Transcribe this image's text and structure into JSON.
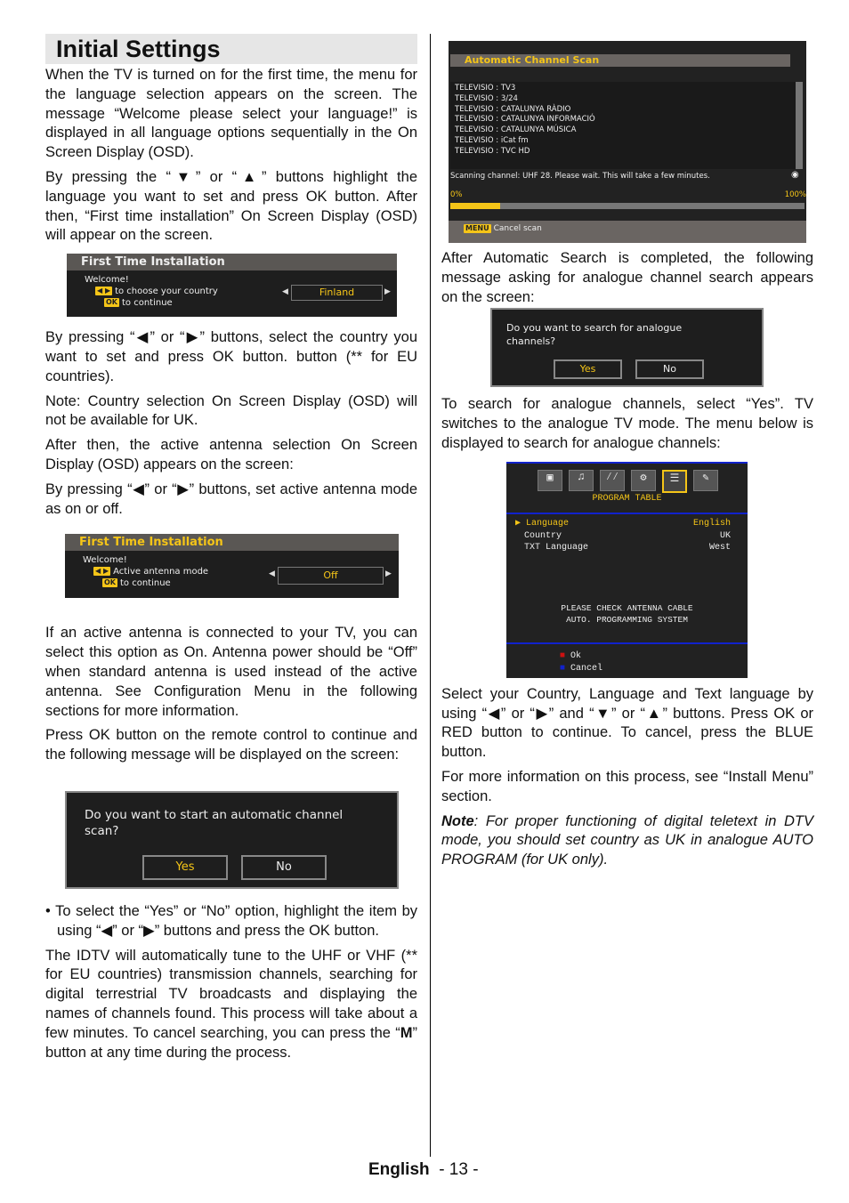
{
  "title": "Initial Settings",
  "left_paragraphs": {
    "p1": "When the TV is turned on for the first time, the menu for the language selection appears on the screen. The message “Welcome please select your language!” is displayed in all language options sequentially in the On Screen Display (OSD).",
    "p2": "By pressing the “▼” or “▲” buttons highlight the language you want to set and press OK button. After then, “First time installation” On Screen Display (OSD) will appear on the screen.",
    "p3": "By pressing “◀” or “▶” buttons, select the country you want to set and press OK button. button (** for EU countries).",
    "p4": "Note: Country selection On Screen Display (OSD) will not be available for UK.",
    "p5": "After then, the active antenna selection On Screen Display (OSD) appears on the screen:",
    "p6": "By pressing “◀” or “▶” buttons, set active antenna mode as on or off.",
    "p7": "If an active antenna is connected to your TV, you can select this option as On. Antenna power should be “Off” when standard antenna is used instead of the active antenna. See Configuration Menu in the following sections for more information.",
    "p8": "Press OK button on the remote control to continue and the following message will be displayed on the screen:",
    "p9": "• To select the “Yes” or “No” option, highlight the item by using “◀” or “▶” buttons and press the OK button.",
    "p10a": "The IDTV will automatically tune to the UHF or VHF (** for EU countries) transmission channels, searching for digital terrestrial TV broadcasts and displaying the names of channels found. This process will take about a few minutes. To cancel searching, you can press the “",
    "p10b": "M",
    "p10c": "” button at any time during the process."
  },
  "right_paragraphs": {
    "p1": "After Automatic Search is completed, the following message asking for analogue channel search appears on the screen:",
    "p2": "To search for analogue channels, select “Yes”.  TV switches to the analogue TV mode. The menu below is displayed to search for analogue channels:",
    "p3": "Select your Country, Language and Text language by using “◀” or “▶” and “▼” or “▲” buttons. Press OK or RED button to continue. To cancel, press the BLUE button.",
    "p4": "For more information on this process, see “Install Menu” section.",
    "p5a": "Note",
    "p5b": ": For proper functioning of digital teletext in DTV mode, you should set country as UK in analogue AUTO PROGRAM (for UK only)."
  },
  "osd_country": {
    "header": "First Time Installation",
    "welcome": "Welcome!",
    "line1": "to choose your country",
    "line2": "to continue",
    "ok_key": "OK",
    "value": "Finland"
  },
  "osd_antenna": {
    "header": "First Time Installation",
    "welcome": "Welcome!",
    "line1": "Active antenna mode",
    "line2": "to continue",
    "ok_key": "OK",
    "value": "Off"
  },
  "osd_scan_prompt": {
    "question": "Do you want to start an automatic channel scan?",
    "yes": "Yes",
    "no": "No"
  },
  "osd_auto_scan": {
    "header": "Automatic Channel Scan",
    "channels": [
      "TELEVISIO : TV3",
      "TELEVISIO : 3/24",
      "TELEVISIO : CATALUNYA RÀDIO",
      "TELEVISIO : CATALUNYA INFORMACIÓ",
      "TELEVISIO : CATALUNYA MÚSICA",
      "TELEVISIO : iCat fm",
      "TELEVISIO : TVC HD"
    ],
    "status": "Scanning channel: UHF 28. Please wait. This will take a few minutes.",
    "min_label": "0%",
    "max_label": "100%",
    "progress_percent": 14,
    "menu_key": "MENU",
    "cancel": "Cancel scan"
  },
  "osd_analogue_prompt": {
    "question": "Do you want to search for analogue channels?",
    "yes": "Yes",
    "no": "No"
  },
  "osd_program_table": {
    "section": "PROGRAM TABLE",
    "rows": [
      {
        "label": "Language",
        "value": "English"
      },
      {
        "label": "Country",
        "value": "UK"
      },
      {
        "label": "TXT Language",
        "value": "West"
      }
    ],
    "message1": "PLEASE CHECK ANTENNA CABLE",
    "message2": "AUTO. PROGRAMMING SYSTEM",
    "ok": "Ok",
    "cancel": "Cancel",
    "colors": {
      "ok": "#cc1111",
      "cancel": "#1122cc",
      "accent": "#f5c518"
    }
  },
  "footer": {
    "language": "English",
    "page": "- 13 -"
  }
}
